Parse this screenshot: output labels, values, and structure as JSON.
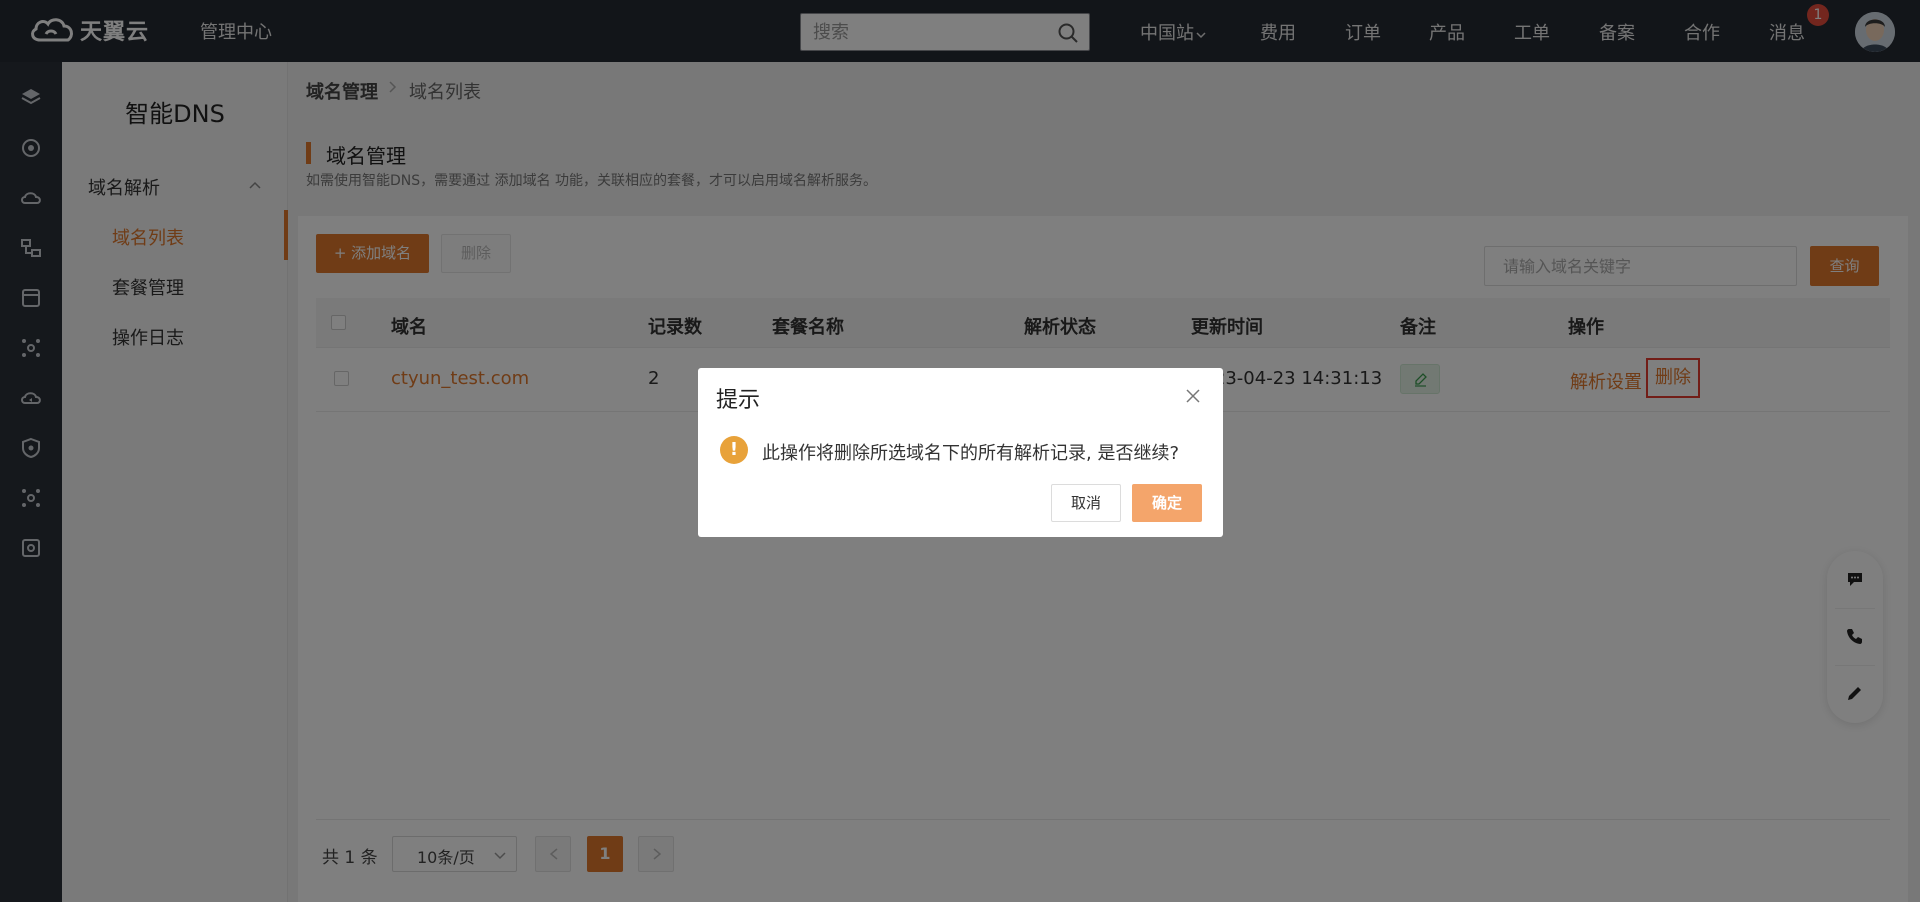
{
  "topbar": {
    "logo_text": "天翼云",
    "management": "管理中心",
    "search_placeholder": "搜索",
    "nav": {
      "region": "中国站",
      "fee": "费用",
      "order": "订单",
      "product": "产品",
      "ticket": "工单",
      "icp": "备案",
      "coop": "合作",
      "message": "消息"
    },
    "message_badge": "1"
  },
  "sidebar": {
    "title": "智能DNS",
    "group": "域名解析",
    "items": [
      "域名列表",
      "套餐管理",
      "操作日志"
    ]
  },
  "breadcrumb": [
    "域名管理",
    "域名列表"
  ],
  "header": {
    "title": "域名管理",
    "description": "如需使用智能DNS，需要通过 添加域名 功能，关联相应的套餐，才可以启用域名解析服务。"
  },
  "toolbar": {
    "add_label": "+ 添加域名",
    "delete_label": "删除",
    "keyword_placeholder": "请输入域名关键字",
    "query_label": "查询"
  },
  "table": {
    "columns": [
      "域名",
      "记录数",
      "套餐名称",
      "解析状态",
      "更新时间",
      "备注",
      "操作"
    ],
    "rows": [
      {
        "domain": "ctyun_test.com",
        "records": "2",
        "updated": "2023-04-23 14:31:13",
        "op_settings": "解析设置",
        "op_delete": "删除"
      }
    ]
  },
  "pagination": {
    "total": "共 1 条",
    "page_size": "10条/页",
    "current": "1"
  },
  "dialog": {
    "title": "提示",
    "warn_glyph": "!",
    "message": "此操作将删除所选域名下的所有解析记录, 是否继续?",
    "cancel": "取消",
    "confirm": "确定"
  },
  "colors": {
    "accent": "#e0782c",
    "topbar": "#252a33",
    "warning": "#e8a23a",
    "highlight_border": "#e53a2f"
  }
}
